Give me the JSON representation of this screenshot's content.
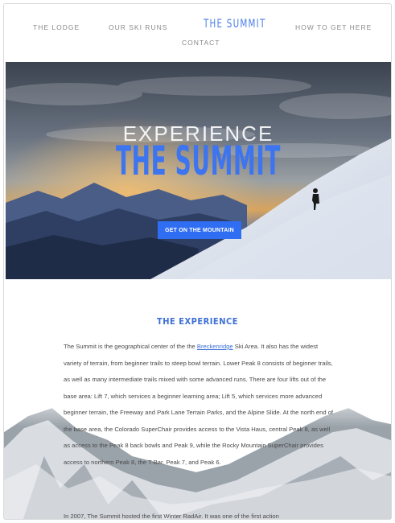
{
  "nav": {
    "lodge": "THE LODGE",
    "runs": "OUR SKI RUNS",
    "brand": "THE SUMMIT",
    "howto": "HOW TO GET HERE",
    "contact": "CONTACT"
  },
  "hero": {
    "pre_title": "EXPERIENCE",
    "title": "THE SUMMIT",
    "button": "GET ON THE MOUNTAIN"
  },
  "experience": {
    "title": "THE EXPERIENCE",
    "p1_before_link": "The Summit is the geographical center of the the ",
    "p1_link": "Breckenridge",
    "p1_after_link": " Ski Area. It also has the widest variety of terrain, from beginner trails to steep bowl terrain. Lower Peak 8 consists of beginner trails, as well as many intermediate trails mixed with some advanced runs. There are four lifts out of the base area: Lift 7, which services a beginner learning area; Lift 5, which services more advanced beginner terrain, the Freeway and Park Lane Terrain Parks, and the Alpine Slide. At the north end of the base area, the Colorado SuperChair provides access to the Vista Haus, central Peak 8, as well as access to the Peak 8 back bowls and Peak 9, while the Rocky Mountain SuperChair provides access to northern Peak 8, the T-Bar, Peak 7, and Peak 6.",
    "p2": "In 2007, The Summit hosted the first Winter RadAir. It was one of the first action"
  },
  "colors": {
    "accent": "#3d74f0",
    "button": "#2f6df2",
    "nav_text": "#8a8a8a"
  }
}
